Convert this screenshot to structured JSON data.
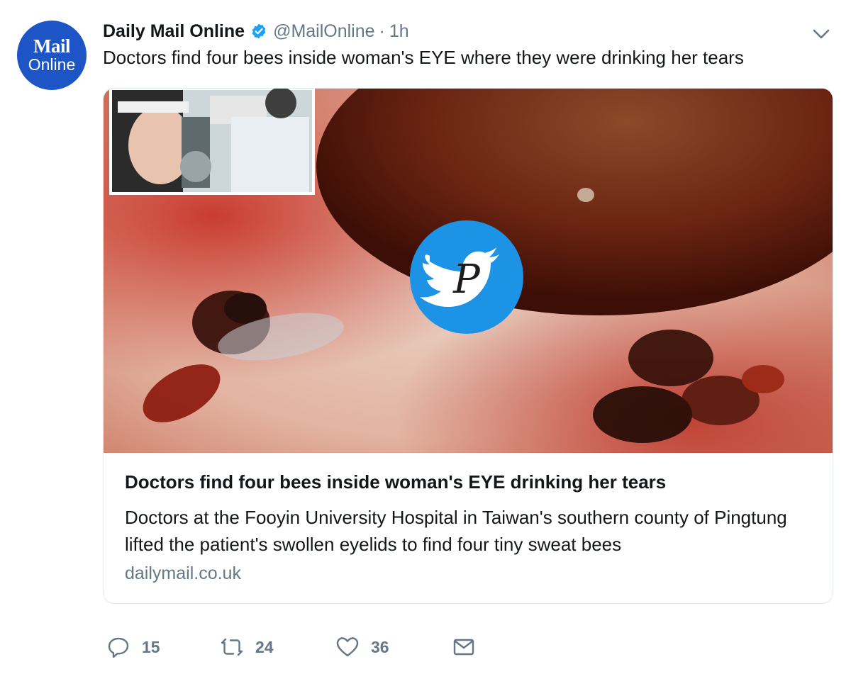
{
  "avatar": {
    "line1": "Mail",
    "line2": "Online"
  },
  "header": {
    "name": "Daily Mail Online",
    "handle": "@MailOnline",
    "separator": "·",
    "time": "1h"
  },
  "tweet": {
    "text": "Doctors find four bees inside woman's EYE where they were drinking her tears"
  },
  "card": {
    "title": "Doctors find four bees inside woman's EYE drinking her tears",
    "description": "Doctors at the Fooyin University Hospital in Taiwan's southern county of Pingtung lifted the patient's swollen eyelids to find four tiny sweat bees",
    "domain": "dailymail.co.uk",
    "watermark_letter": "P"
  },
  "actions": {
    "replies": "15",
    "retweets": "24",
    "likes": "36"
  },
  "colors": {
    "avatar_bg": "#1e55c6",
    "verified": "#1da1f2",
    "secondary_text": "#657786",
    "watermark": "#1d93e6"
  }
}
